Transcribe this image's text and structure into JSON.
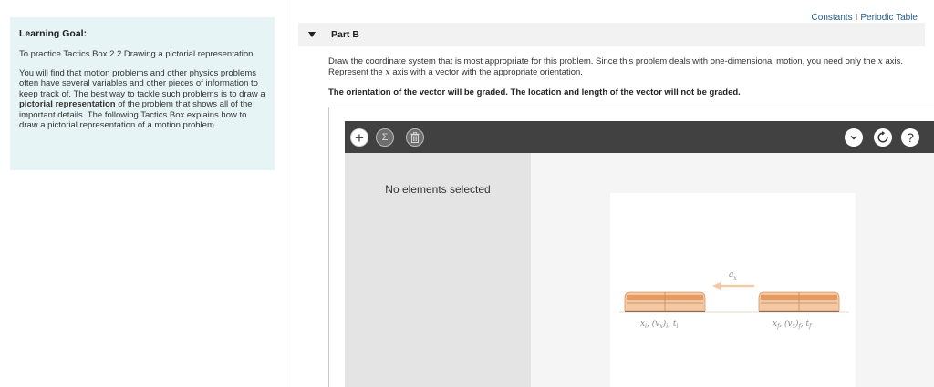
{
  "learning_goal": {
    "title": "Learning Goal:",
    "paragraph1": "To practice Tactics Box 2.2 Drawing a pictorial representation.",
    "paragraph2_before": "You will find that motion problems and other physics problems often have several variables and other pieces of information to keep track of. The best way to tackle such problems is to draw a ",
    "paragraph2_bold": "pictorial representation",
    "paragraph2_after": " of the problem that shows all of the important details. The following Tactics Box explains how to draw a pictorial representation of a motion problem."
  },
  "top_links": {
    "constants": "Constants",
    "separator": "I",
    "periodic_table": "Periodic Table"
  },
  "part": {
    "title": "Part B",
    "instructions_a": "Draw the coordinate system that is most appropriate for this problem. Since this problem deals with one-dimensional motion, you need only the ",
    "instructions_var1": "x",
    "instructions_b": " axis. Represent the ",
    "instructions_var2": "x",
    "instructions_c": " axis with a vector with the appropriate orientation.",
    "graded_note": "The orientation of the vector will be graded. The location and length of the vector will not be graded."
  },
  "tool": {
    "side_message": "No elements selected",
    "sum_symbol": "Σ",
    "help_symbol": "?"
  },
  "figure": {
    "accel_label": "a",
    "accel_sub": "x",
    "left_label_x": "x",
    "left_label_x_sub": "i",
    "left_label_v": "(v",
    "left_label_v_sub": "x",
    "left_label_v_close": ")",
    "left_label_v_close_sub": "i",
    "left_label_t": "t",
    "left_label_t_sub": "i",
    "right_label_x": "x",
    "right_label_x_sub": "f",
    "right_label_v": "(v",
    "right_label_v_sub": "x",
    "right_label_v_close": ")",
    "right_label_v_close_sub": "f",
    "right_label_t": "t",
    "right_label_t_sub": "f"
  },
  "colors": {
    "goal_bg": "#e6f4f6",
    "toolbar_bg": "#414141",
    "link": "#1f5d8c",
    "train_body": "#f3c8a3",
    "train_stripe": "#e89a63",
    "arrow": "#f6c89f"
  }
}
